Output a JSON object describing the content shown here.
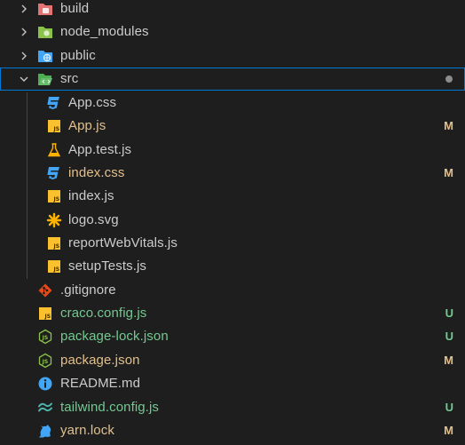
{
  "items": [
    {
      "label": "build",
      "badge": ""
    },
    {
      "label": "node_modules",
      "badge": ""
    },
    {
      "label": "public",
      "badge": ""
    },
    {
      "label": "src",
      "badge": ""
    },
    {
      "label": "App.css",
      "badge": ""
    },
    {
      "label": "App.js",
      "badge": "M"
    },
    {
      "label": "App.test.js",
      "badge": ""
    },
    {
      "label": "index.css",
      "badge": "M"
    },
    {
      "label": "index.js",
      "badge": ""
    },
    {
      "label": "logo.svg",
      "badge": ""
    },
    {
      "label": "reportWebVitals.js",
      "badge": ""
    },
    {
      "label": "setupTests.js",
      "badge": ""
    },
    {
      "label": ".gitignore",
      "badge": ""
    },
    {
      "label": "craco.config.js",
      "badge": "U"
    },
    {
      "label": "package-lock.json",
      "badge": "U"
    },
    {
      "label": "package.json",
      "badge": "M"
    },
    {
      "label": "README.md",
      "badge": ""
    },
    {
      "label": "tailwind.config.js",
      "badge": "U"
    },
    {
      "label": "yarn.lock",
      "badge": "M"
    }
  ],
  "colors": {
    "background": "#1e1e1e",
    "text": "#cccccc",
    "modified": "#e2c08d",
    "untracked": "#73c991",
    "selection_border": "#0078d4"
  }
}
